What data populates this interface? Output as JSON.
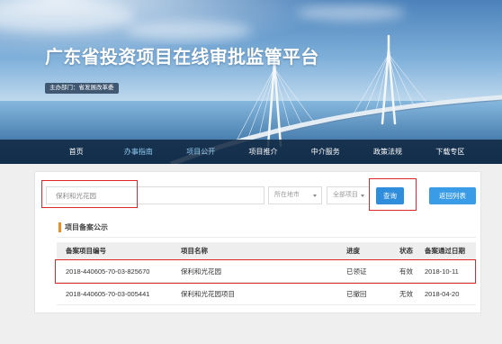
{
  "header": {
    "title": "广东省投资项目在线审批监管平台",
    "sponsor": "主办部门：省发展改革委"
  },
  "nav": {
    "items": [
      {
        "label": "首页",
        "active": false,
        "highlight": false
      },
      {
        "label": "办事指南",
        "active": false,
        "highlight": true
      },
      {
        "label": "项目公开",
        "active": true,
        "highlight": true
      },
      {
        "label": "项目推介",
        "active": false,
        "highlight": false
      },
      {
        "label": "中介服务",
        "active": false,
        "highlight": false
      },
      {
        "label": "政策法规",
        "active": false,
        "highlight": false
      },
      {
        "label": "下载专区",
        "active": false,
        "highlight": false
      }
    ]
  },
  "search": {
    "query": "保利和光花园",
    "city_select": "所在地市",
    "project_select": "全部项目",
    "submit_label": "查询",
    "back_label": "返回列表"
  },
  "section": {
    "title": "项目备案公示"
  },
  "table": {
    "columns": [
      "备案项目编号",
      "项目名称",
      "进度",
      "状态",
      "备案通过日期"
    ],
    "rows": [
      [
        "2018-440605-70-03-825670",
        "保利和光花园",
        "已领证",
        "有效",
        "2018-10-11"
      ],
      [
        "2018-440605-70-03-005441",
        "保利和光花园项目",
        "已撤回",
        "无效",
        "2018-04-20"
      ]
    ]
  },
  "colors": {
    "accent": "#2f8ddb",
    "accent2": "#3a9be6",
    "annotation_red": "#e0262d",
    "section_bar": "#f08c22",
    "nav_highlight": "#8fcaf0"
  },
  "icons": {
    "select_caret": "chevron-down-icon"
  }
}
